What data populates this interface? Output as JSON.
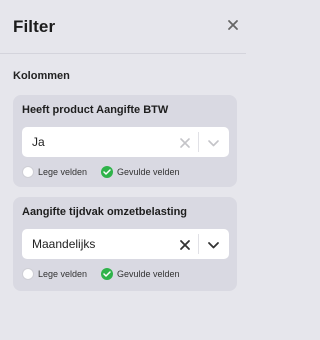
{
  "header": {
    "title": "Filter",
    "close_icon": "close-icon"
  },
  "section": {
    "label": "Kolommen"
  },
  "filters": [
    {
      "title": "Heeft product Aangifte BTW",
      "value": "Ja",
      "clear_enabled": false,
      "options": [
        {
          "label": "Lege velden",
          "checked": false
        },
        {
          "label": "Gevulde velden",
          "checked": true
        }
      ]
    },
    {
      "title": "Aangifte tijdvak omzetbelasting",
      "value": "Maandelijks",
      "clear_enabled": true,
      "options": [
        {
          "label": "Lege velden",
          "checked": false
        },
        {
          "label": "Gevulde velden",
          "checked": true
        }
      ]
    }
  ],
  "colors": {
    "background": "#e6e6ec",
    "card": "#d9d9e2",
    "check": "#2fb34a"
  }
}
